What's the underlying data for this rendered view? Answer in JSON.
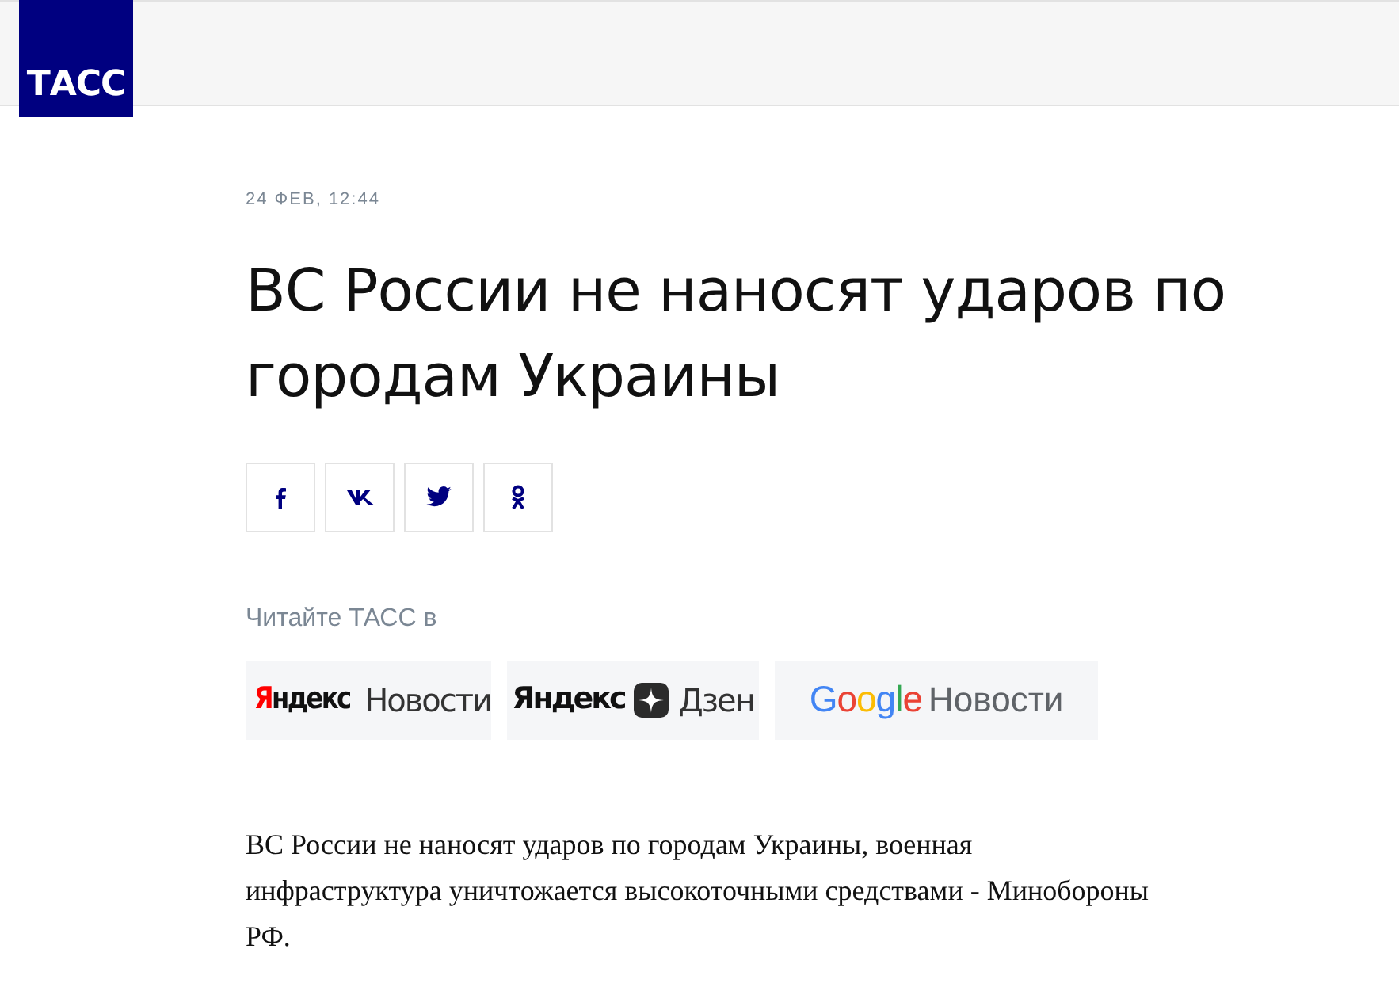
{
  "logo": {
    "text": "ТАСС"
  },
  "article": {
    "date": "24 ФЕВ, 12:44",
    "title": "ВС России не наносят ударов по городам Украины",
    "read_in": "Читайте ТАСС в",
    "partners": [
      {
        "kind": "yandex-news",
        "brand": "Яндекс",
        "name": "Новости"
      },
      {
        "kind": "zen",
        "brand": "Яндекс",
        "name": "Дзен"
      },
      {
        "kind": "google-news",
        "brand": "Google",
        "name": "Новости"
      }
    ],
    "body": "ВС России не наносят ударов по городам Украины, военная инфраструктура уничтожается высокоточными средствами - Минобороны РФ."
  }
}
